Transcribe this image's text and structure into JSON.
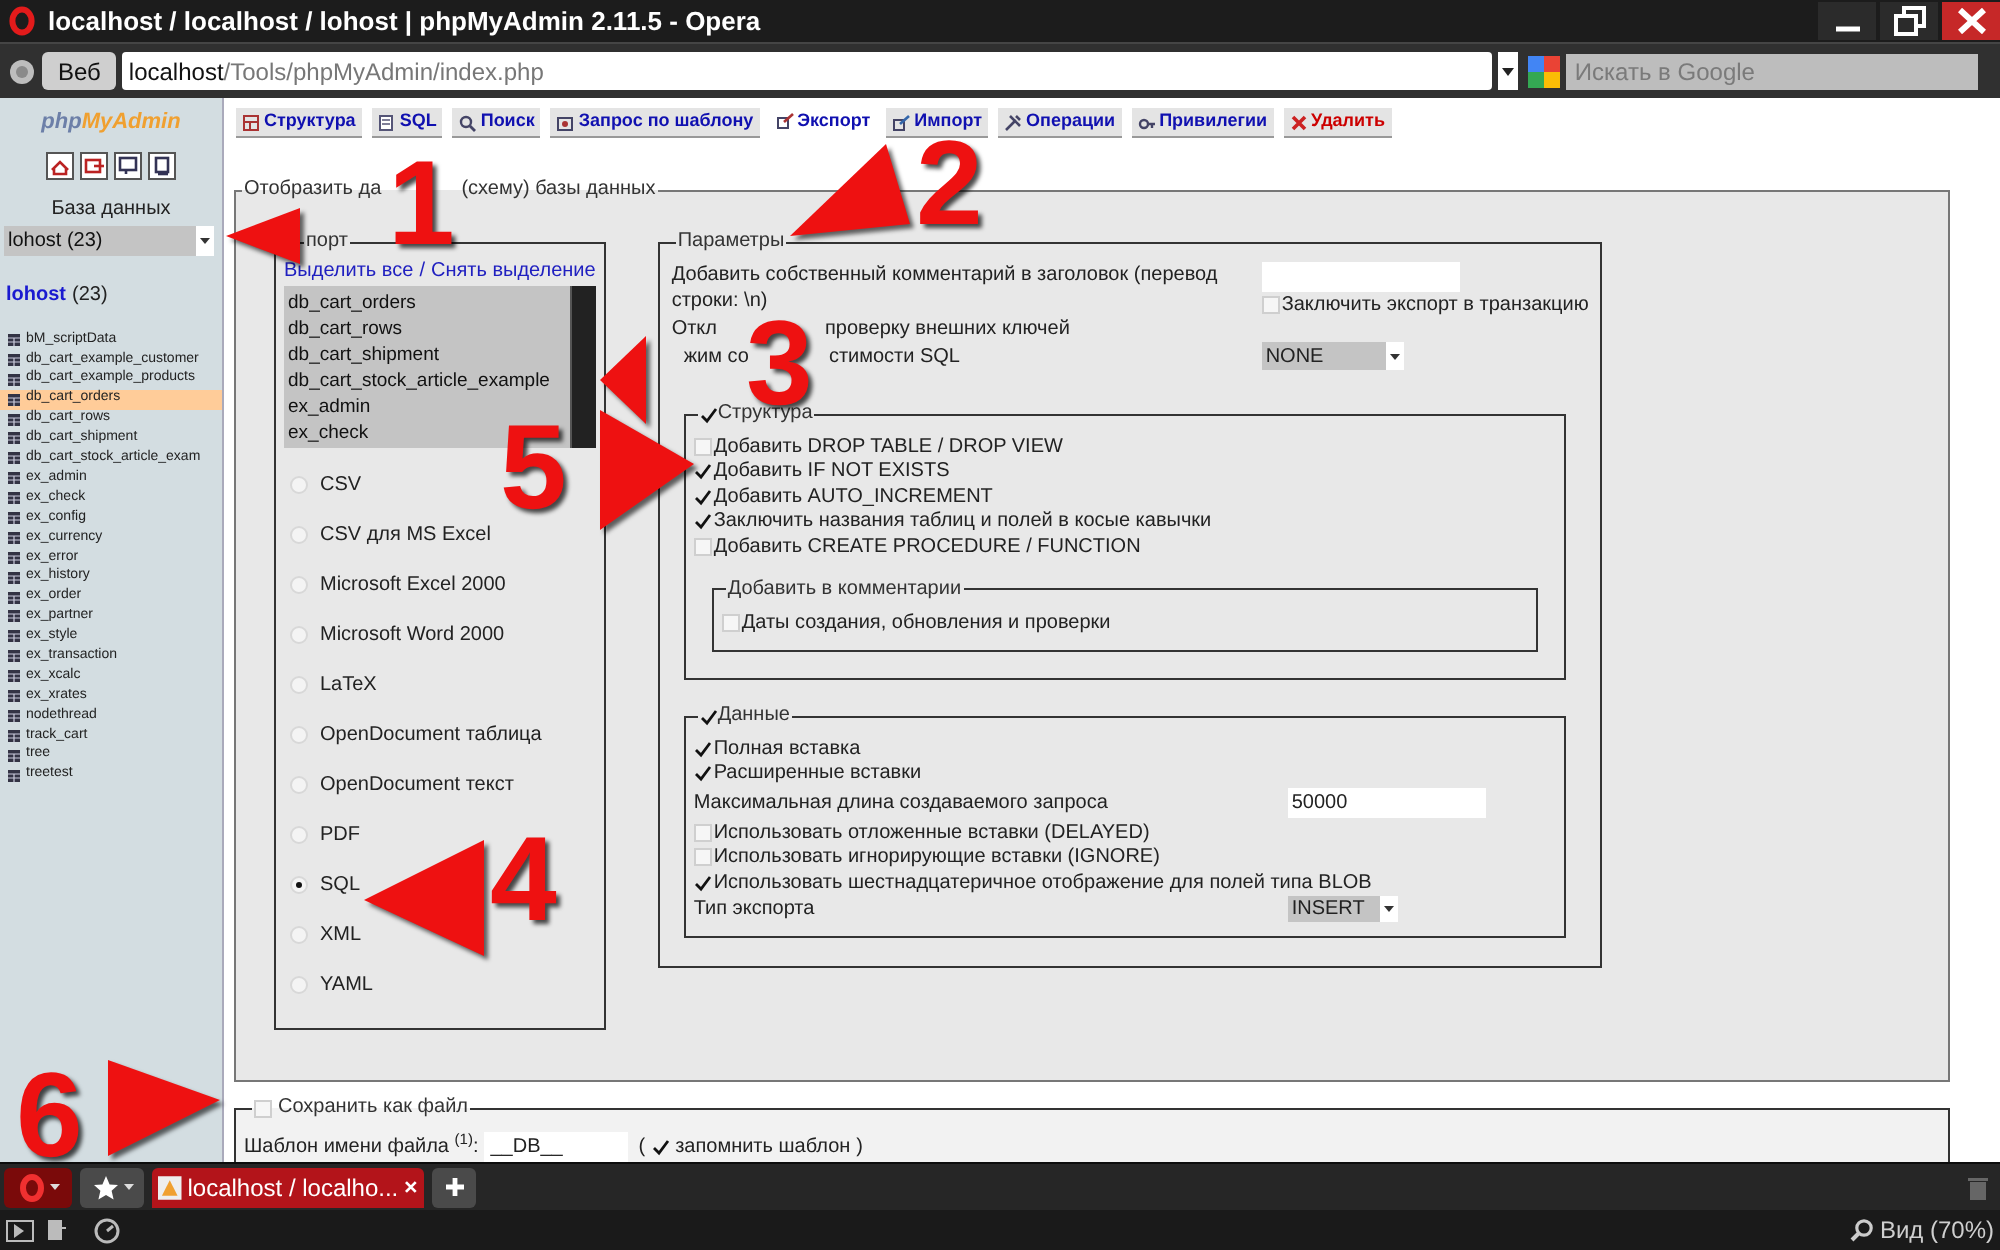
{
  "window": {
    "title": "localhost / localhost / lohost | phpMyAdmin 2.11.5 - Opera"
  },
  "address_bar": {
    "web_button": "Веб",
    "url_host": "localhost",
    "url_path": "/Tools/phpMyAdmin/index.php",
    "search_placeholder": "Искать в Google"
  },
  "sidebar": {
    "logo_php": "php",
    "logo_myadmin": "MyAdmin",
    "database_label": "База данных",
    "database_select": "lohost (23)",
    "db_link": "lohost",
    "db_count": "(23)",
    "tables": [
      {
        "name": "bM_scriptData",
        "selected": false
      },
      {
        "name": "db_cart_example_customer",
        "selected": false
      },
      {
        "name": "db_cart_example_products",
        "selected": false
      },
      {
        "name": "db_cart_orders",
        "selected": true
      },
      {
        "name": "db_cart_rows",
        "selected": false
      },
      {
        "name": "db_cart_shipment",
        "selected": false
      },
      {
        "name": "db_cart_stock_article_exam",
        "selected": false
      },
      {
        "name": "ex_admin",
        "selected": false
      },
      {
        "name": "ex_check",
        "selected": false
      },
      {
        "name": "ex_config",
        "selected": false
      },
      {
        "name": "ex_currency",
        "selected": false
      },
      {
        "name": "ex_error",
        "selected": false
      },
      {
        "name": "ex_history",
        "selected": false
      },
      {
        "name": "ex_order",
        "selected": false
      },
      {
        "name": "ex_partner",
        "selected": false
      },
      {
        "name": "ex_style",
        "selected": false
      },
      {
        "name": "ex_transaction",
        "selected": false
      },
      {
        "name": "ex_xcalc",
        "selected": false
      },
      {
        "name": "ex_xrates",
        "selected": false
      },
      {
        "name": "nodethread",
        "selected": false
      },
      {
        "name": "track_cart",
        "selected": false
      },
      {
        "name": "tree",
        "selected": false
      },
      {
        "name": "treetest",
        "selected": false
      }
    ]
  },
  "tabs": [
    {
      "label": "Структура",
      "selected": false,
      "kind": "normal"
    },
    {
      "label": "SQL",
      "selected": false,
      "kind": "normal"
    },
    {
      "label": "Поиск",
      "selected": false,
      "kind": "normal"
    },
    {
      "label": "Запрос по шаблону",
      "selected": false,
      "kind": "normal"
    },
    {
      "label": "Экспорт",
      "selected": true,
      "kind": "normal"
    },
    {
      "label": "Импорт",
      "selected": false,
      "kind": "normal"
    },
    {
      "label": "Операции",
      "selected": false,
      "kind": "normal"
    },
    {
      "label": "Привилегии",
      "selected": false,
      "kind": "normal"
    },
    {
      "label": "Удалить",
      "selected": false,
      "kind": "danger"
    }
  ],
  "export_panel": {
    "legend_parts": [
      "Отобразить да",
      "(схему) базы данных"
    ],
    "export_box": {
      "legend": "порт",
      "select_all": "Выделить все",
      "separator": "/",
      "unselect_all": "Снять выделение",
      "tables": [
        {
          "name": "db_cart_orders",
          "selected": true
        },
        {
          "name": "db_cart_rows",
          "selected": true
        },
        {
          "name": "db_cart_shipment",
          "selected": true
        },
        {
          "name": "db_cart_stock_article_example",
          "selected": true
        },
        {
          "name": "ex_admin",
          "selected": true
        },
        {
          "name": "ex_check",
          "selected": true
        }
      ],
      "formats": [
        {
          "label": "CSV",
          "selected": false
        },
        {
          "label": "CSV для MS Excel",
          "selected": false
        },
        {
          "label": "Microsoft Excel 2000",
          "selected": false
        },
        {
          "label": "Microsoft Word 2000",
          "selected": false
        },
        {
          "label": "LaTeX",
          "selected": false
        },
        {
          "label": "OpenDocument таблица",
          "selected": false
        },
        {
          "label": "OpenDocument текст",
          "selected": false
        },
        {
          "label": "PDF",
          "selected": false
        },
        {
          "label": "SQL",
          "selected": true
        },
        {
          "label": "XML",
          "selected": false
        },
        {
          "label": "YAML",
          "selected": false
        }
      ]
    },
    "parameters": {
      "legend": "Параметры",
      "comment_label": "Добавить собственный комментарий в заголовок (перевод строки: \\n)",
      "transaction": {
        "label": "Заключить экспорт в транзакцию",
        "checked": false
      },
      "foreign_keys_parts": [
        "Откл",
        "проверку внешних ключей"
      ],
      "compat_parts": [
        "жим со",
        "стимости SQL"
      ],
      "compat_value": "NONE",
      "structure": {
        "legend": "Структура",
        "checked": true,
        "options": [
          {
            "label": "Добавить DROP TABLE / DROP VIEW",
            "checked": false
          },
          {
            "label": "Добавить IF NOT EXISTS",
            "checked": true
          },
          {
            "label": "Добавить AUTO_INCREMENT",
            "checked": true
          },
          {
            "label": "Заключить названия таблиц и полей в косые кавычки",
            "checked": true
          },
          {
            "label": "Добавить CREATE PROCEDURE / FUNCTION",
            "checked": false
          }
        ],
        "comments": {
          "legend": "Добавить в комментарии",
          "options": [
            {
              "label": "Даты создания, обновления и проверки",
              "checked": false
            }
          ]
        }
      },
      "data": {
        "legend": "Данные",
        "checked": true,
        "options": [
          {
            "kind": "checkbox",
            "label": "Полная вставка",
            "checked": true
          },
          {
            "kind": "checkbox",
            "label": "Расширенные вставки",
            "checked": true
          },
          {
            "kind": "input",
            "label": "Максимальная длина создаваемого запроса",
            "value": "50000"
          },
          {
            "kind": "checkbox",
            "label": "Использовать отложенные вставки (DELAYED)",
            "checked": false
          },
          {
            "kind": "checkbox",
            "label": "Использовать игнорирующие вставки (IGNORE)",
            "checked": false
          },
          {
            "kind": "checkbox",
            "label": "Использовать шестнадцатеричное отображение для полей типа BLOB",
            "checked": true
          },
          {
            "kind": "select",
            "label": "Тип экспорта",
            "value": "INSERT"
          }
        ]
      }
    }
  },
  "save_file": {
    "legend": "Сохранить как файл",
    "checked": false,
    "template_label": "Шаблон имени файла $^{(1)}$:",
    "template_value": "__DB__",
    "open_paren": "(",
    "remember_label": "запомнить шаблон",
    "remember_checked": true,
    "close_paren": ")"
  },
  "browser_tabs": [
    {
      "label": "localhost / localho...",
      "selected": true
    }
  ],
  "status_bar": {
    "zoom": "Вид (70%)"
  },
  "annotations": [
    {
      "label": "1"
    },
    {
      "label": "2"
    },
    {
      "label": "3"
    },
    {
      "label": "4"
    },
    {
      "label": "5"
    },
    {
      "label": "6"
    }
  ]
}
